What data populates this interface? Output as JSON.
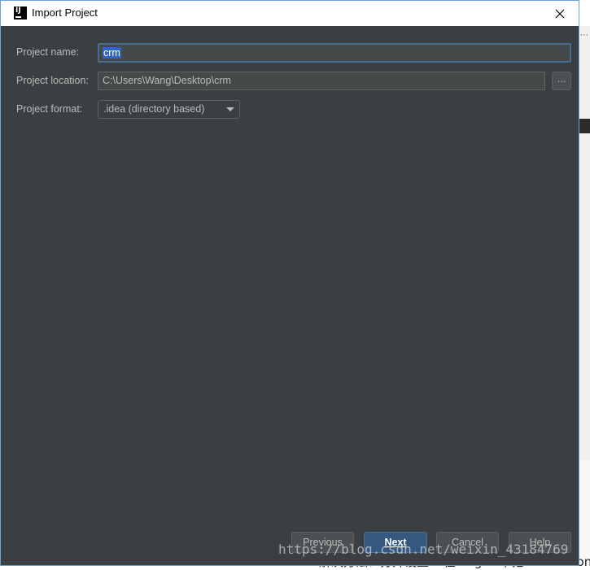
{
  "window": {
    "title": "Import Project"
  },
  "form": {
    "name_label": "Project name:",
    "name_value": "crm",
    "location_label": "Project location:",
    "location_value": "C:\\Users\\Wang\\Desktop\\crm",
    "browse_label": "...",
    "format_label": "Project format:",
    "format_value": ".idea (directory based)"
  },
  "buttons": {
    "previous": "Previous",
    "next": "Next",
    "cancel": "Cancel",
    "help": "Help"
  },
  "background": {
    "bottom_text": "解决方法：打开设置->在Plugins中把Subversion",
    "watermark": "https://blog.csdn.net/weixin_43184769"
  },
  "colors": {
    "dialog_bg": "#3c3f41",
    "field_bg": "#45494a",
    "focus_border": "#466d94",
    "selection": "#2f65ca",
    "primary_button": "#365880"
  },
  "icons": {
    "app": "intellij-icon",
    "close": "close-icon",
    "dropdown": "chevron-down-icon"
  }
}
